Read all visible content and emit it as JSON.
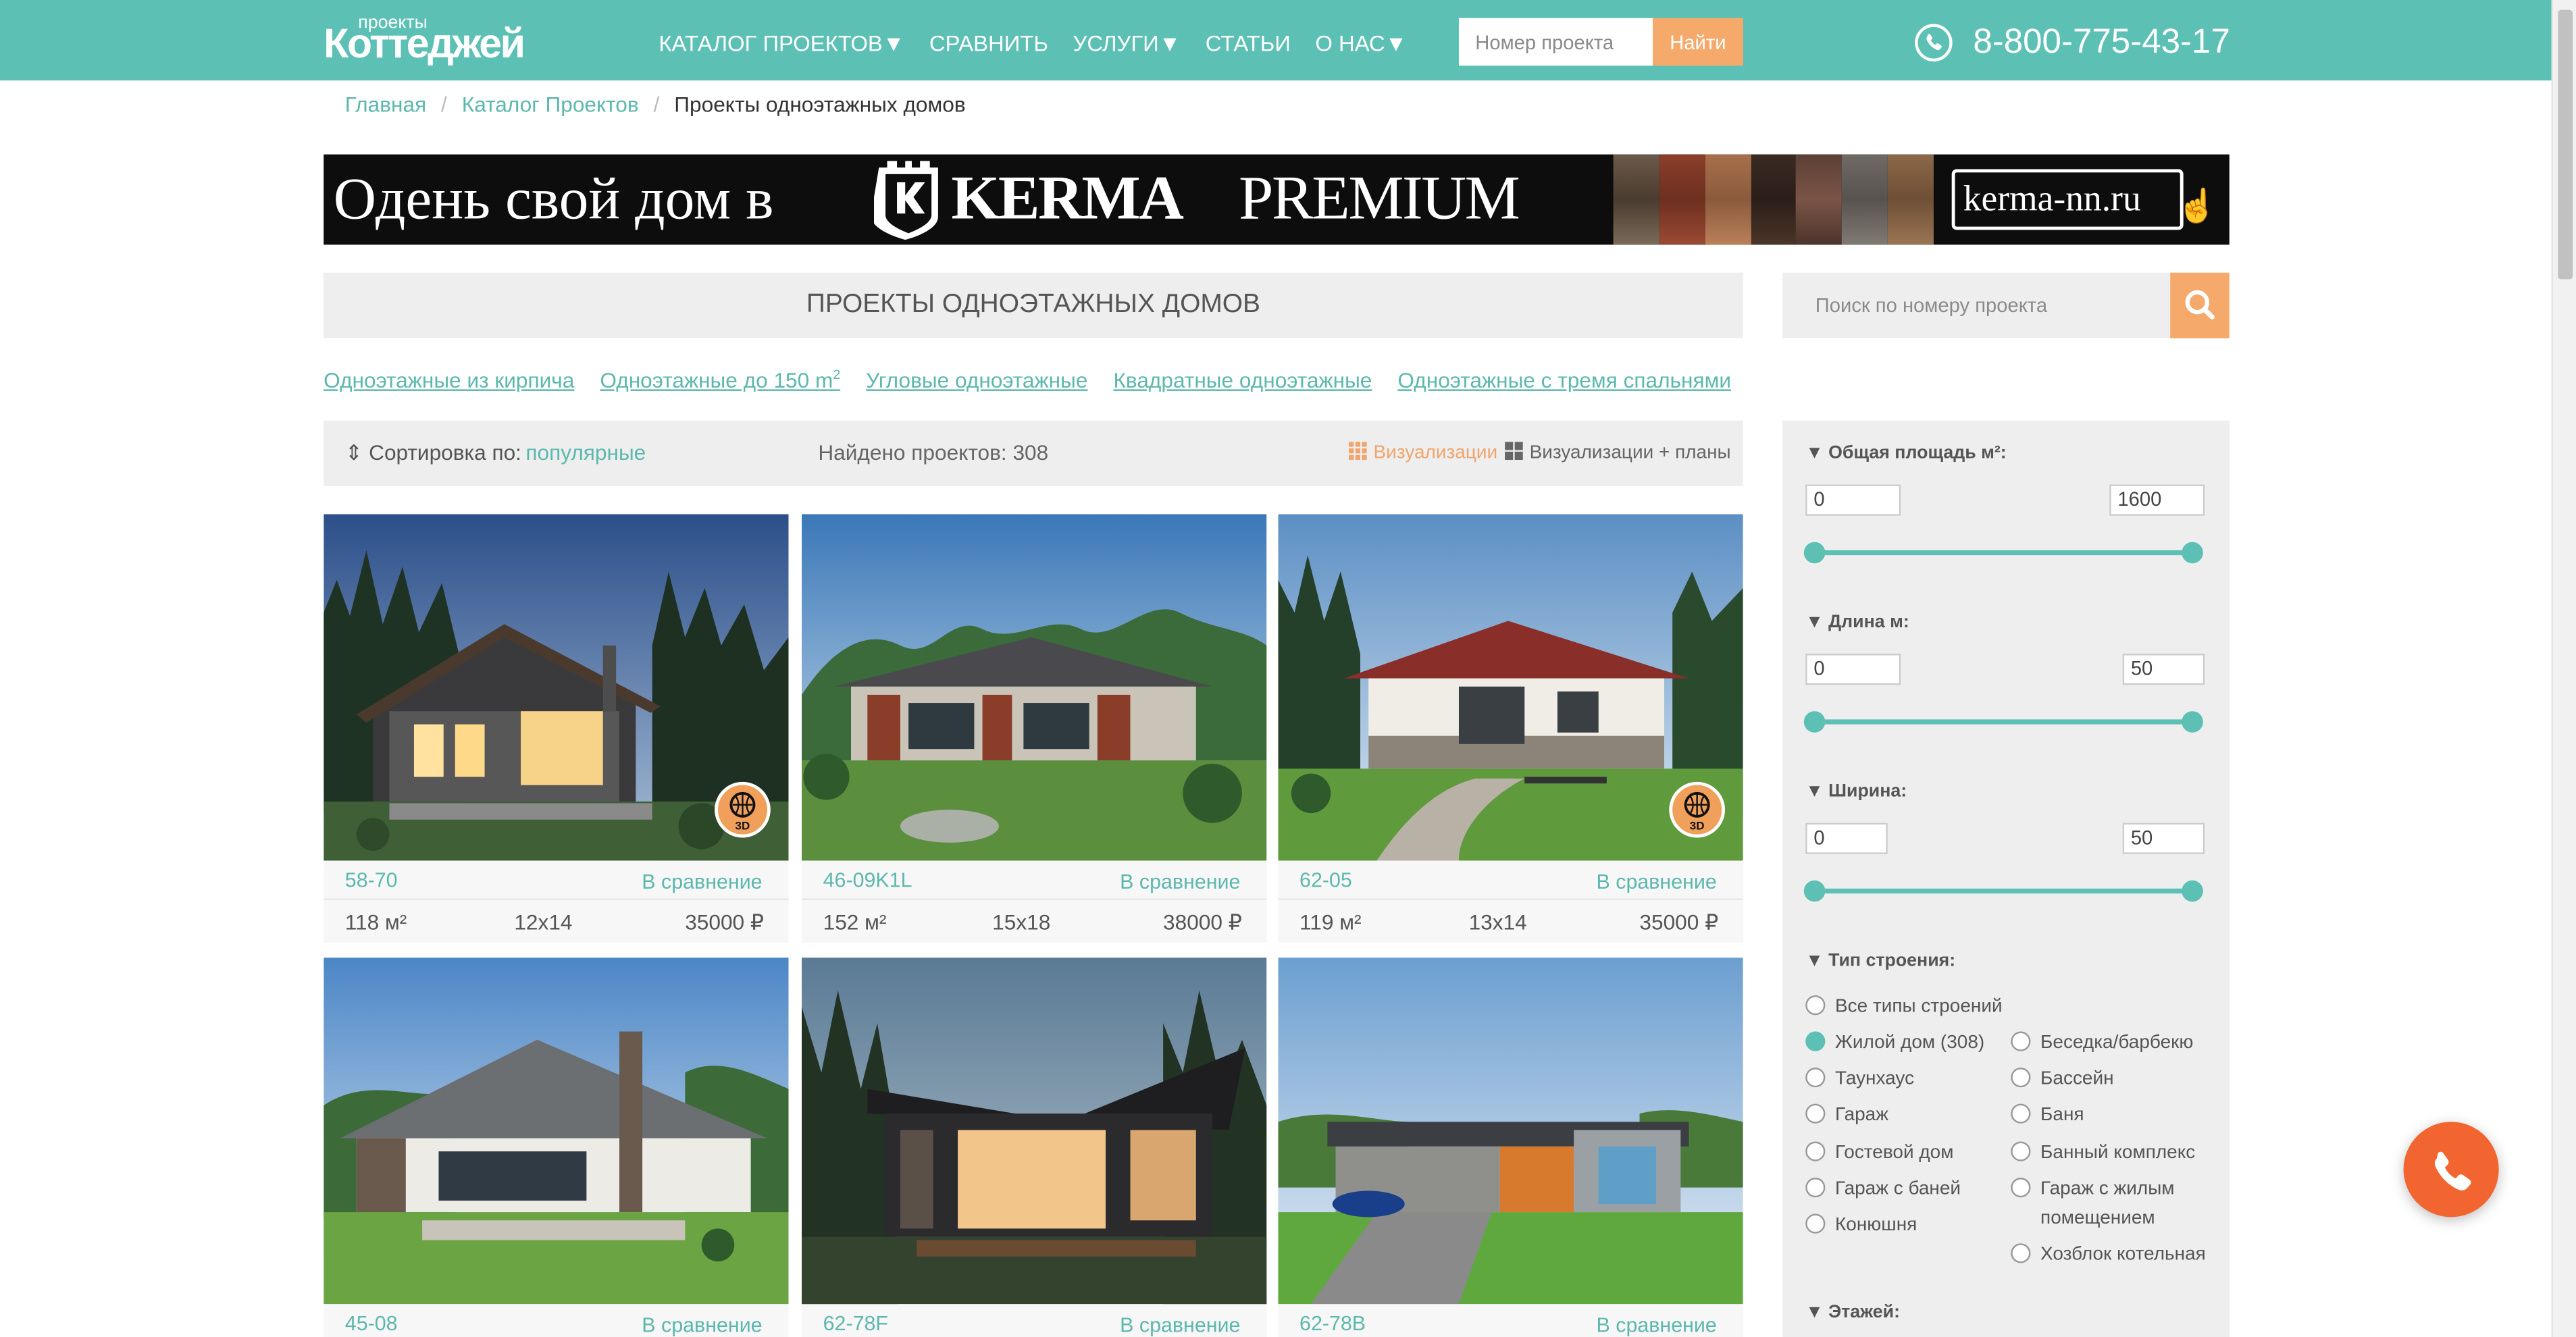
{
  "header": {
    "logo_small": "проекты",
    "logo_big": "Коттеджей",
    "nav": [
      "КАТАЛОГ ПРОЕКТОВ▼",
      "СРАВНИТЬ",
      "УСЛУГИ▼",
      "СТАТЬИ",
      "О НАС▼"
    ],
    "search_placeholder": "Номер проекта",
    "search_button": "Найти",
    "phone": "8-800-775-43-17"
  },
  "breadcrumb": {
    "home": "Главная",
    "catalog": "Каталог Проектов",
    "current": "Проекты одноэтажных домов"
  },
  "banner": {
    "text": "Одень свой дом в",
    "brand": "KERMA",
    "brand2": "PREMIUM",
    "site": "kerma-nn.ru"
  },
  "page_title": "ПРОЕКТЫ ОДНОЭТАЖНЫХ ДОМОВ",
  "project_search_placeholder": "Поиск по номеру проекта",
  "tags": [
    {
      "label": "Одноэтажные из кирпича"
    },
    {
      "label": "Одноэтажные до 150 m",
      "sup": "2"
    },
    {
      "label": "Угловые одноэтажные"
    },
    {
      "label": "Квадратные одноэтажные"
    },
    {
      "label": "Одноэтажные с тремя спальнями"
    }
  ],
  "sort": {
    "label": "Сортировка по:",
    "value": "популярные",
    "found": "Найдено проектов: 308",
    "view1": "Визуализации",
    "view2": "Визуализации + планы"
  },
  "projects": [
    {
      "name": "58-70",
      "compare": "В сравнение",
      "area": "118 м²",
      "size": "12x14",
      "price": "35000 ₽",
      "badge3d": true
    },
    {
      "name": "46-09K1L",
      "compare": "В сравнение",
      "area": "152 м²",
      "size": "15x18",
      "price": "38000 ₽",
      "badge3d": false
    },
    {
      "name": "62-05",
      "compare": "В сравнение",
      "area": "119 м²",
      "size": "13x14",
      "price": "35000 ₽",
      "badge3d": true
    },
    {
      "name": "45-08",
      "compare": "В сравнение"
    },
    {
      "name": "62-78F",
      "compare": "В сравнение"
    },
    {
      "name": "62-78B",
      "compare": "В сравнение"
    }
  ],
  "filters": {
    "area": {
      "label": "▼ Общая площадь м²:",
      "min": "0",
      "max": "1600"
    },
    "length": {
      "label": "▼ Длина м:",
      "min": "0",
      "max": "50"
    },
    "width": {
      "label": "▼ Ширина:",
      "min": "0",
      "max": "50"
    },
    "type_label": "▼ Тип строения:",
    "types_left": [
      "Все типы строений",
      "Жилой дом (308)",
      "Таунхаус",
      "Гараж",
      "Гостевой дом",
      "Гараж с баней",
      "Конюшня"
    ],
    "types_right": [
      "Беседка/барбекю",
      "Бассейн",
      "Баня",
      "Банный комплекс",
      "Гараж с жилым",
      "помещением",
      "Хозблок котельная"
    ],
    "floors_label": "▼ Этажей:"
  },
  "colors": {
    "accent": "#5cc0b5",
    "orange": "#f5a96b",
    "call": "#f26430"
  }
}
